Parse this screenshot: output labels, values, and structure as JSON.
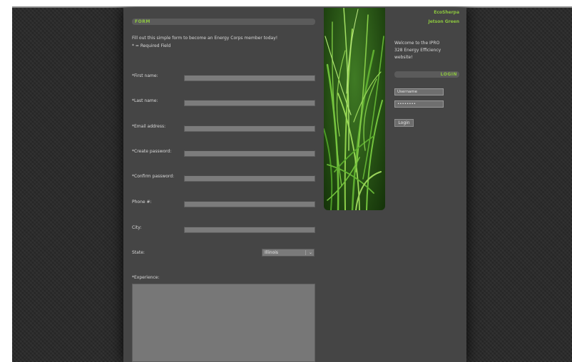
{
  "form": {
    "header": "FORM",
    "intro": "Fill out this simple form to become an Energy Corps member today!",
    "required_note": "* = Required Field",
    "fields": {
      "first_name": "*First name:",
      "last_name": "*Last name:",
      "email": "*Email address:",
      "create_password": "*Create password:",
      "confirm_password": "*Confirm password:",
      "phone": "Phone #:",
      "city": "City:",
      "state": "State:",
      "experience": "*Experience:"
    },
    "state_selected": "Illinois"
  },
  "sidebar": {
    "links": [
      "EcoSherpa",
      "Jetson Green"
    ],
    "welcome_lines": [
      "Welcome to the IPRO",
      "328 Energy Efficiency",
      "website!"
    ],
    "login_header": "LOGIN",
    "username_placeholder": "Username",
    "password_placeholder": "••••••••",
    "login_button": "Login"
  },
  "colors": {
    "accent": "#8cc63f",
    "panel": "#454545",
    "input": "#7c7c7c"
  }
}
